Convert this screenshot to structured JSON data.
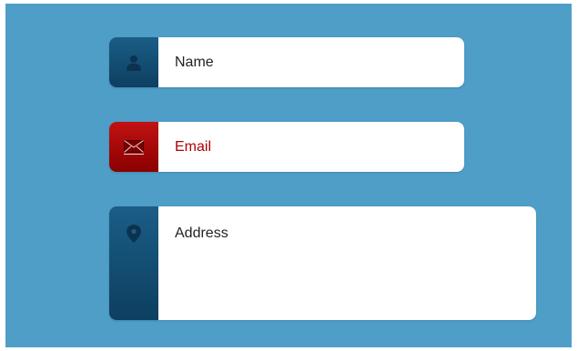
{
  "form": {
    "name": {
      "placeholder": "Name",
      "icon": "user-icon",
      "accent": "#1b5d86"
    },
    "email": {
      "placeholder": "Email",
      "icon": "envelope-icon",
      "accent": "#c21212",
      "text_color": "#b00000"
    },
    "address": {
      "placeholder": "Address",
      "icon": "map-pin-icon",
      "accent": "#1b5d86"
    }
  },
  "colors": {
    "background": "#4e9ec8",
    "field_background": "#ffffff"
  }
}
